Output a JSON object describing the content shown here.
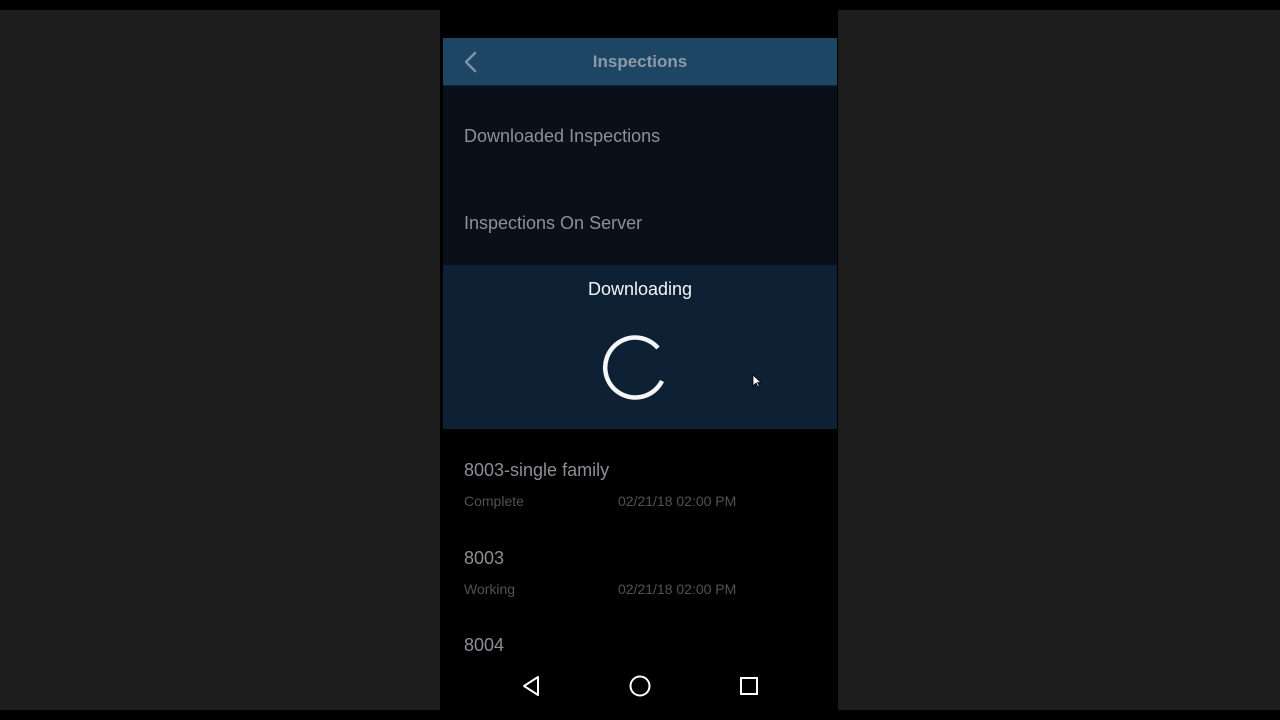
{
  "app_bar": {
    "title": "Inspections",
    "background": "#1d4564"
  },
  "menu": {
    "items": [
      {
        "label": "Downloaded Inspections"
      },
      {
        "label": "Inspections On Server"
      }
    ]
  },
  "dialog": {
    "title": "Downloading",
    "background": "#0e2134"
  },
  "inspections": [
    {
      "name": "8003-single family",
      "status": "Complete",
      "date": "02/21/18 02:00 PM"
    },
    {
      "name": "8003",
      "status": "Working",
      "date": "02/21/18 02:00 PM"
    },
    {
      "name": "8004"
    }
  ],
  "icons": {
    "back": "chevron-left-icon",
    "spinner": "loading-spinner-icon",
    "nav_back": "triangle-back-icon",
    "nav_home": "circle-home-icon",
    "nav_recents": "square-recents-icon",
    "cursor": "mouse-pointer-icon"
  }
}
